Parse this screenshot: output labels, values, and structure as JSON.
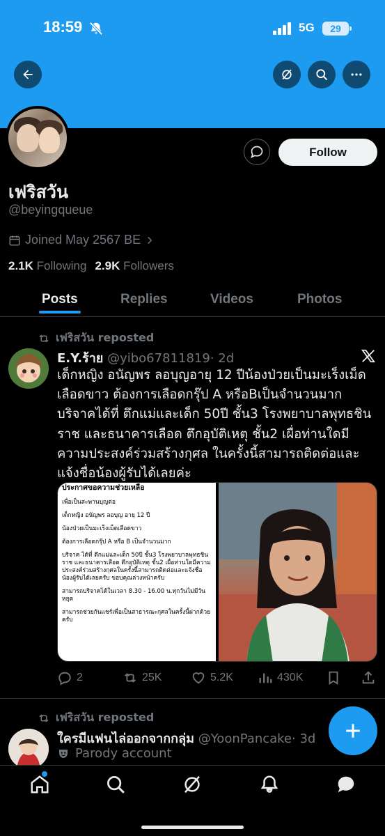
{
  "status_bar": {
    "time": "18:59",
    "network": "5G",
    "battery": "29"
  },
  "profile": {
    "display_name": "เฟริสวัน",
    "handle": "@beyingqueue",
    "joined": "Joined May 2567 BE",
    "following_count": "2.1K",
    "following_label": "Following",
    "followers_count": "2.9K",
    "followers_label": "Followers",
    "follow_label": "Follow"
  },
  "tabs": [
    {
      "label": "Posts",
      "active": true
    },
    {
      "label": "Replies",
      "active": false
    },
    {
      "label": "Videos",
      "active": false
    },
    {
      "label": "Photos",
      "active": false
    }
  ],
  "posts": [
    {
      "reposted_by": "เฟริสวัน reposted",
      "author_name": "E.Y.ร้าย",
      "author_handle": "@yibo67811819",
      "time": "· 2d",
      "text": "เด็กหญิง อนัญพร ลอบุญอายุ 12 ปีน้องป่วยเป็นมะเร็งเม็ดเลือดขาว ต้องการเลือดกรุ๊ป A หรือBเป็นจำนวนมาก บริจาคได้ที่ ตึกแม่และเด็ก 50ปี ชั้น3 โรงพยาบาลพุทธชินราช และธนาคารเลือด ตึกอุบัติเหตุ ชั้น2 เผื่อท่านใดมีความประสงค์ร่วมสร้างกุศล ในครั้งนี้สามารถติดต่อและแจ้งชื่อน้องผู้รับได้เลยค่ะ",
      "doc": {
        "title": "ประกาศขอความช่วยเหลือ",
        "lines": [
          "เพื่อเป็นสะพานบุญต่อ",
          "",
          "เด็กหญิง อนัญพร ลอบุญ อายุ 12 ปี",
          "น้องป่วยเป็นมะเร็งเม็ดเลือดขาว",
          "ต้องการเลือดกรุ๊ป A หรือ B เป็นจำนวนมาก",
          "บริจาค ได้ที่ ตึกแม่และเด็ก 50ปี ชั้น3 โรงพยาบาลพุทธชินราช และธนาคารเลือด ตึกอุบัติเหตุ ชั้น2 เผื่อท่านใดมีความประสงค์ร่วมสร้างกุศลในครั้งนี้สามารถติดต่อและแจ้งชื่อน้องผู้รับได้เลยครับ ขอบคุณล่วงหน้าครับ",
          "สามารถบริจาคได้ในเวลา 8.30 - 16.00 น.ทุกวันไม่มีวันหยุด",
          "สามารถช่วยกันแชร์เพื่อเป็นสาธารณะกุศลในครั้งนี้ฝากด้วยครับ"
        ]
      },
      "replies": "2",
      "reposts": "25K",
      "likes": "5.2K",
      "views": "430K"
    },
    {
      "reposted_by": "เฟริสวัน reposted",
      "author_name": "ใครมีแฟนไล่ออกจากกลุ่ม",
      "author_handle": "@YoonPancake",
      "time": "· 3d",
      "badge": "Parody account"
    }
  ],
  "colors": {
    "accent": "#1d9bf0",
    "background": "#000000",
    "muted": "#71767b"
  }
}
